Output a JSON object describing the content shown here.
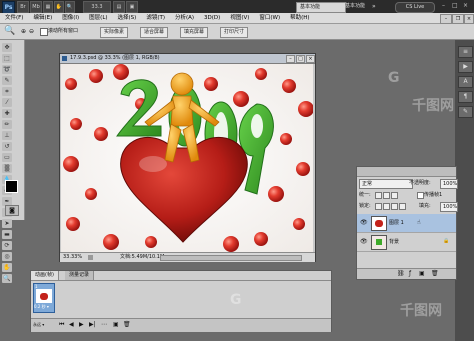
{
  "app": {
    "logo": "Ps",
    "zoom_value": "33.3",
    "workspace_buttons": [
      "基本功能",
      "基本功能"
    ],
    "cslive": "CS Live"
  },
  "menu": [
    "文件(F)",
    "编辑(E)",
    "图像(I)",
    "图层(L)",
    "选择(S)",
    "滤镜(T)",
    "分析(A)",
    "3D(D)",
    "视图(V)",
    "窗口(W)",
    "帮助(H)"
  ],
  "options": {
    "scroll_all_windows": "滚动所有窗口",
    "actual_pixels": "实际像素",
    "fit_screen": "适合屏幕",
    "fill_screen": "填充屏幕",
    "print_size": "打印尺寸"
  },
  "document": {
    "tab_title": "17.9.3.psd @ 33.3% (图层 1, RGB/8)",
    "canvas_number": "2009",
    "zoom": "33.33%",
    "doc_info": "文档:5.49M/10.1M"
  },
  "layers": {
    "mode": "正常",
    "opacity_label": "不透明度:",
    "opacity_value": "100%",
    "unify_label": "统一:",
    "propagate_label": "传播帧1",
    "lock_label": "锁定:",
    "fill_label": "填充:",
    "fill_value": "100%",
    "items": [
      {
        "name": "图层 1"
      },
      {
        "name": "背景"
      }
    ]
  },
  "animation": {
    "tabs": [
      "动画(帧)",
      "测量记录"
    ],
    "frame_number": "1",
    "frame_delay": "0.2 秒 ▾",
    "loop": "永远 ▾"
  },
  "watermark": "千图网",
  "colors": {
    "heart": "#c3221b",
    "number_green": "#3faa2a",
    "figure": "#f1a51c",
    "dots": "#e33b2e"
  }
}
